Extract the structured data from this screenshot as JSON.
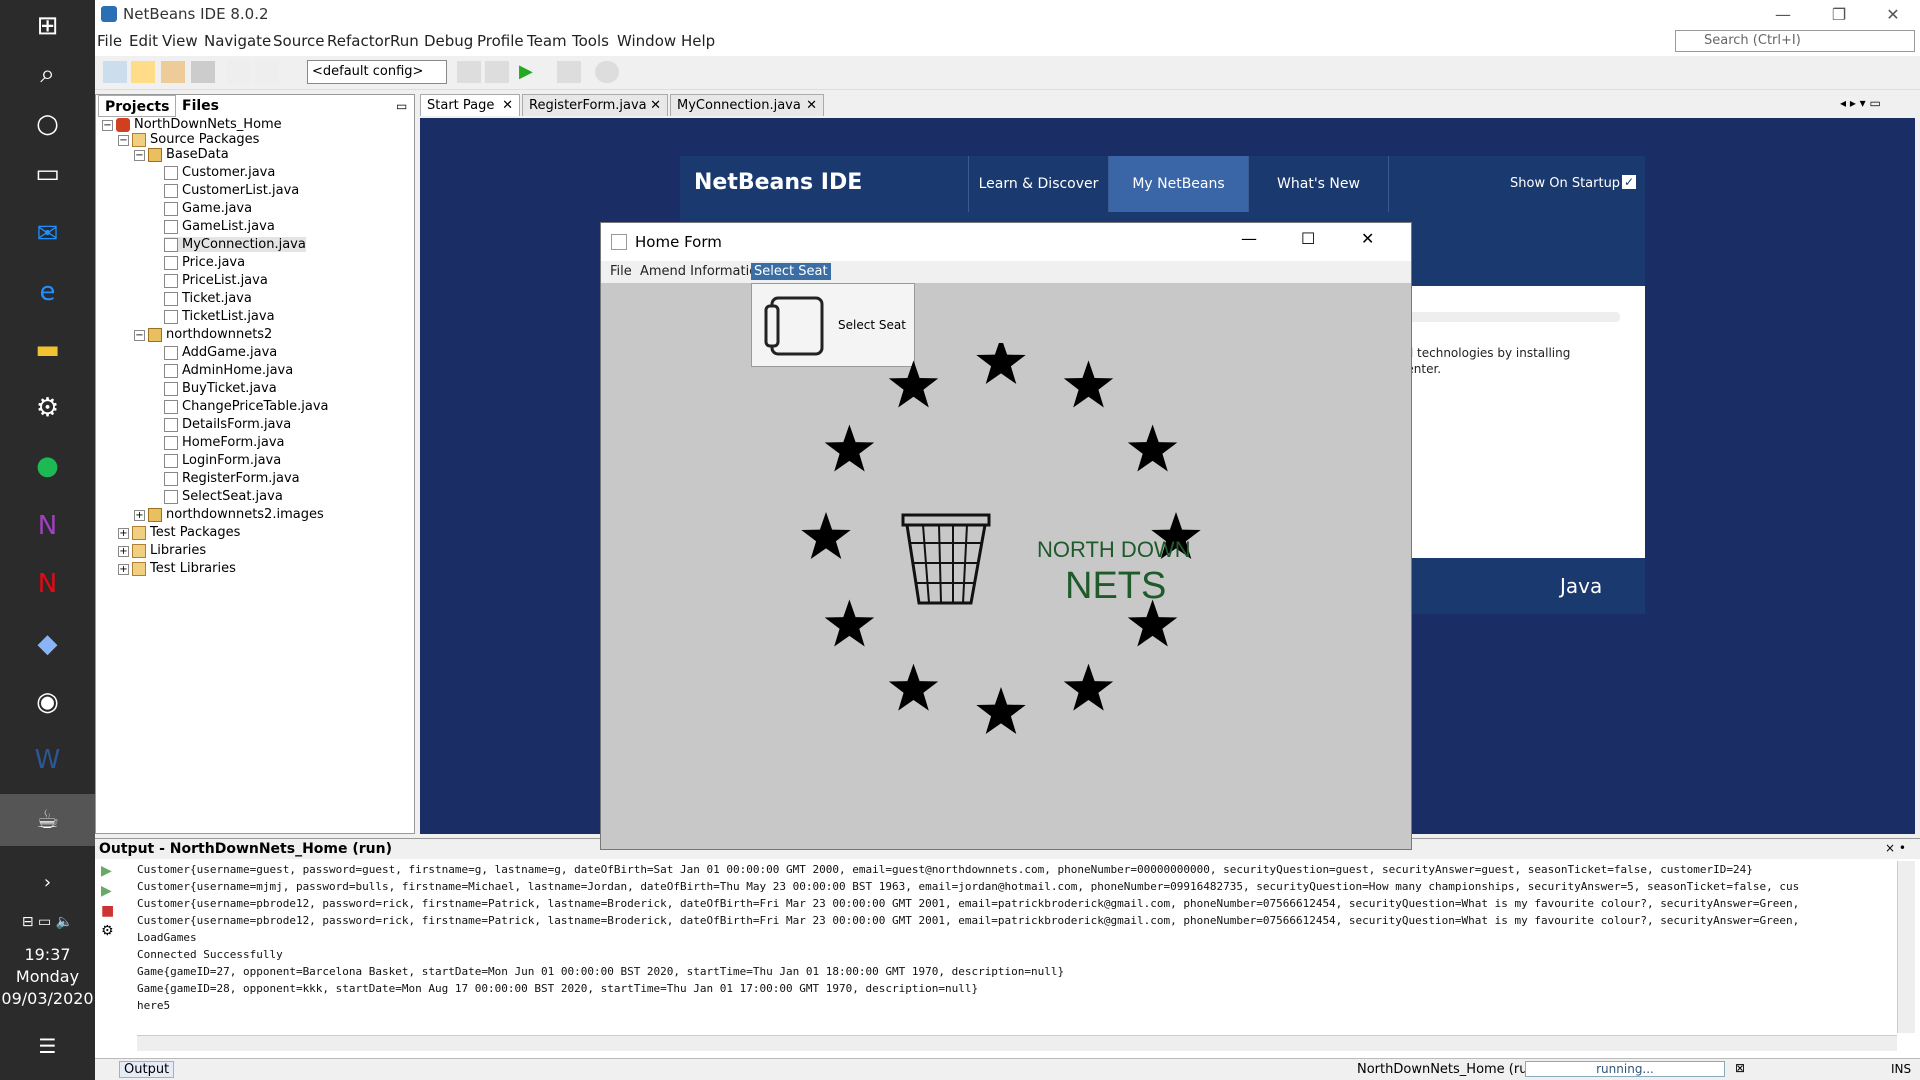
{
  "taskbar": {
    "clock_time": "19:37",
    "clock_day": "Monday",
    "clock_date": "09/03/2020"
  },
  "ide": {
    "window_title": "NetBeans IDE 8.0.2",
    "menu": [
      "File",
      "Edit",
      "View",
      "Navigate",
      "Source",
      "Refactor",
      "Run",
      "Debug",
      "Profile",
      "Team",
      "Tools",
      "Window",
      "Help"
    ],
    "search_placeholder": "Search (Ctrl+I)",
    "config_value": "<default config>",
    "project_tabs": [
      "Projects",
      "Files"
    ],
    "tree": {
      "project": "NorthDownNets_Home",
      "source_packages": "Source Packages",
      "basedata": "BaseData",
      "basedata_files": [
        "Customer.java",
        "CustomerList.java",
        "Game.java",
        "GameList.java",
        "MyConnection.java",
        "Price.java",
        "PriceList.java",
        "Ticket.java",
        "TicketList.java"
      ],
      "northdownnets2": "northdownnets2",
      "nd2_files": [
        "AddGame.java",
        "AdminHome.java",
        "BuyTicket.java",
        "ChangePriceTable.java",
        "DetailsForm.java",
        "HomeForm.java",
        "LoginForm.java",
        "RegisterForm.java",
        "SelectSeat.java"
      ],
      "images_pkg": "northdownnets2.images",
      "test_packages": "Test Packages",
      "libraries": "Libraries",
      "test_libraries": "Test Libraries"
    },
    "editor_tabs": [
      "Start Page",
      "RegisterForm.java",
      "MyConnection.java"
    ],
    "startpage": {
      "logo_text": "NetBeans IDE",
      "nav": [
        "Learn & Discover",
        "My NetBeans",
        "What's New"
      ],
      "show_on_startup": "Show On Startup",
      "body_line1": "nd technologies by installing",
      "body_line2": "Center.",
      "java_logo": "Java"
    },
    "output": {
      "header": "Output - NorthDownNets_Home (run)",
      "lines": [
        "Customer{username=guest, password=guest, firstname=g, lastname=g, dateOfBirth=Sat Jan 01 00:00:00 GMT 2000, email=guest@northdownnets.com, phoneNumber=00000000000, securityQuestion=guest, securityAnswer=guest, seasonTicket=false, customerID=24}",
        "Customer{username=mjmj, password=bulls, firstname=Michael, lastname=Jordan, dateOfBirth=Thu May 23 00:00:00 BST 1963, email=jordan@hotmail.com, phoneNumber=09916482735, securityQuestion=How many championships, securityAnswer=5, seasonTicket=false, cus",
        "Customer{username=pbrode12, password=rick, firstname=Patrick, lastname=Broderick, dateOfBirth=Fri Mar 23 00:00:00 GMT 2001, email=patrickbroderick@gmail.com, phoneNumber=07566612454, securityQuestion=What is my favourite colour?, securityAnswer=Green,",
        "Customer{username=pbrode12, password=rick, firstname=Patrick, lastname=Broderick, dateOfBirth=Fri Mar 23 00:00:00 GMT 2001, email=patrickbroderick@gmail.com, phoneNumber=07566612454, securityQuestion=What is my favourite colour?, securityAnswer=Green,",
        "LoadGames",
        "Connected Successfully",
        "Game{gameID=27, opponent=Barcelona Basket, startDate=Mon Jun 01 00:00:00 BST 2020, startTime=Thu Jan 01 18:00:00 GMT 1970, description=null}",
        "Game{gameID=28, opponent=kkk, startDate=Mon Aug 17 00:00:00 BST 2020, startTime=Thu Jan 01 17:00:00 GMT 1970, description=null}",
        "here5"
      ]
    },
    "status": {
      "output_tab": "Output",
      "run_label": "NorthDownNets_Home (run)",
      "progress": "running...",
      "mode": "INS"
    }
  },
  "home_form": {
    "title": "Home Form",
    "menu": [
      "File",
      "Amend Information",
      "Select Seat"
    ],
    "popup_item": "Select Seat",
    "logo_line1": "NORTH DOWN",
    "logo_line2": "NETS",
    "star_count": 12
  }
}
